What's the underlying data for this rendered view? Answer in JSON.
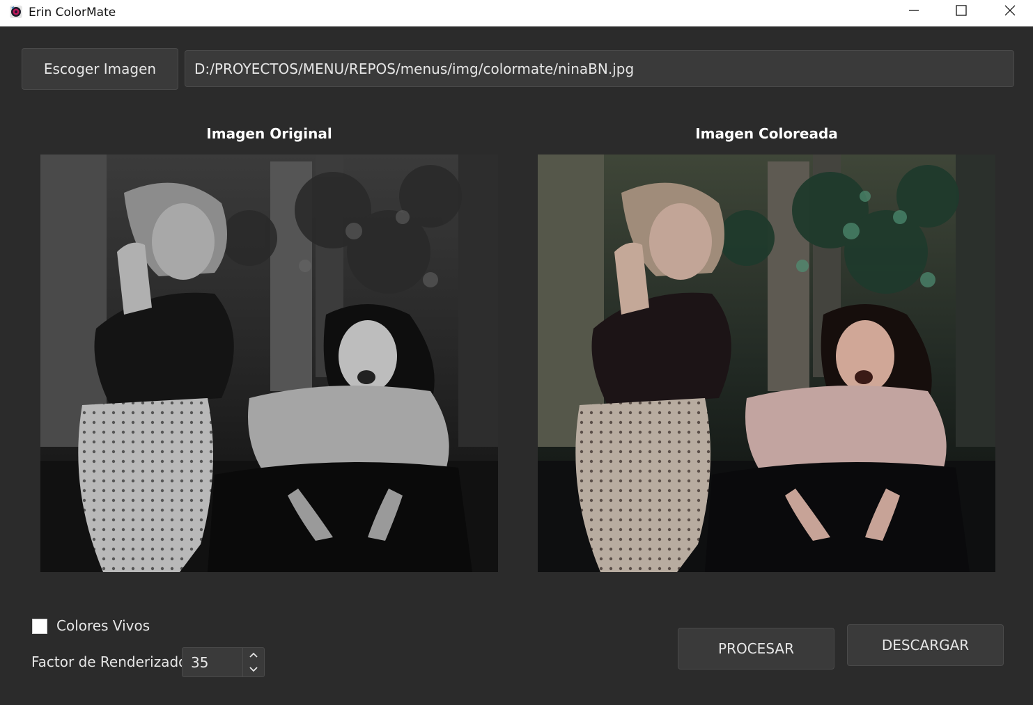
{
  "window": {
    "title": "Erin ColorMate",
    "icon": "colormate-app-icon",
    "controls": {
      "minimize_icon": "minimize-icon",
      "maximize_icon": "maximize-icon",
      "close_icon": "close-icon"
    }
  },
  "toolbar": {
    "choose_button_label": "Escoger Imagen",
    "path_value": "D:/PROYECTOS/MENU/REPOS/menus/img/colormate/ninaBN.jpg"
  },
  "panels": {
    "original_title": "Imagen Original",
    "colored_title": "Imagen Coloreada"
  },
  "options": {
    "vivid_colors_label": "Colores Vivos",
    "vivid_colors_checked": false,
    "render_factor_label": "Factor de Renderizado",
    "render_factor_value": "35"
  },
  "actions": {
    "process_label": "PROCESAR",
    "download_label": "DESCARGAR"
  },
  "colors": {
    "background": "#2b2b2b",
    "control_bg": "#3a3a3a",
    "control_border": "#4a4a4a",
    "text": "#e6e6e6",
    "titlebar": "#ffffff"
  }
}
